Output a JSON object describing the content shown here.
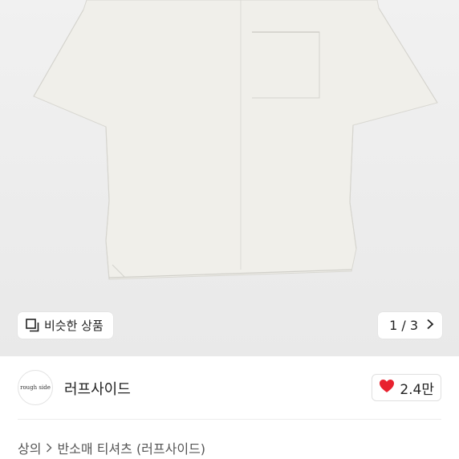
{
  "hero": {
    "image_alt": "white short sleeve shirt",
    "similar_button": {
      "label": "비슷한 상품",
      "icon": "similar-items-icon"
    },
    "pager": {
      "text": "1 / 3",
      "icon": "chevron-right-icon"
    }
  },
  "shop": {
    "logo_text": "rough side",
    "name": "러프사이드",
    "likes": {
      "count": "2.4만",
      "icon": "heart-icon",
      "color": "#e8212e"
    }
  },
  "breadcrumb": {
    "category": "상의",
    "separator_icon": "chevron-right-icon",
    "subcategory": "반소매 티셔츠 (러프사이드)"
  }
}
